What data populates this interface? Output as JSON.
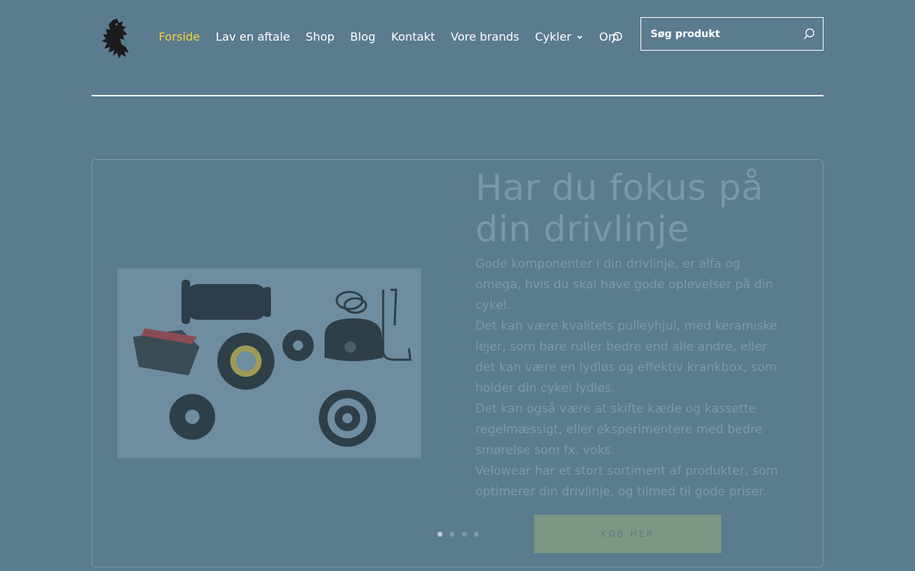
{
  "header": {
    "logo_icon": "lion-rampant-icon",
    "nav": [
      {
        "label": "Forside",
        "active": true
      },
      {
        "label": "Lav en aftale"
      },
      {
        "label": "Shop"
      },
      {
        "label": "Blog"
      },
      {
        "label": "Kontakt"
      },
      {
        "label": "Vore brands"
      },
      {
        "label": "Cykler",
        "has_dropdown": true
      },
      {
        "label": "Om"
      }
    ],
    "search": {
      "placeholder": "Søg produkt",
      "value": ""
    }
  },
  "colors": {
    "background": "#5b7b8f",
    "active_nav": "#f0d43a",
    "cta_bg": "#7c9783"
  },
  "slide": {
    "title": "Har du fokus på din drivlinje",
    "paragraphs": [
      "Gode komponenter i din drivlinje, er alfa og omega, hvis du skal have gode oplevelser på din cykel.",
      "Det kan være kvalitets pulleyhjul, med keramiske lejer, som bare ruller bedre end alle andre, eller det kan være en lydløs og effektiv krankbox, som holder din cykel lydløs.",
      "Det kan også være at skifte kæde og kassette regelmæssigt, eller eksperimentere med bedre smørelse som fx. voks.",
      "Velowear har et stort sortiment af produkter, som optimerer din drivlinje, og tilmed til gode priser."
    ],
    "cta_label": "KØB HER",
    "image_icon": "drivetrain-components-image"
  },
  "slider": {
    "slide_count": 4,
    "active_index": 0
  }
}
